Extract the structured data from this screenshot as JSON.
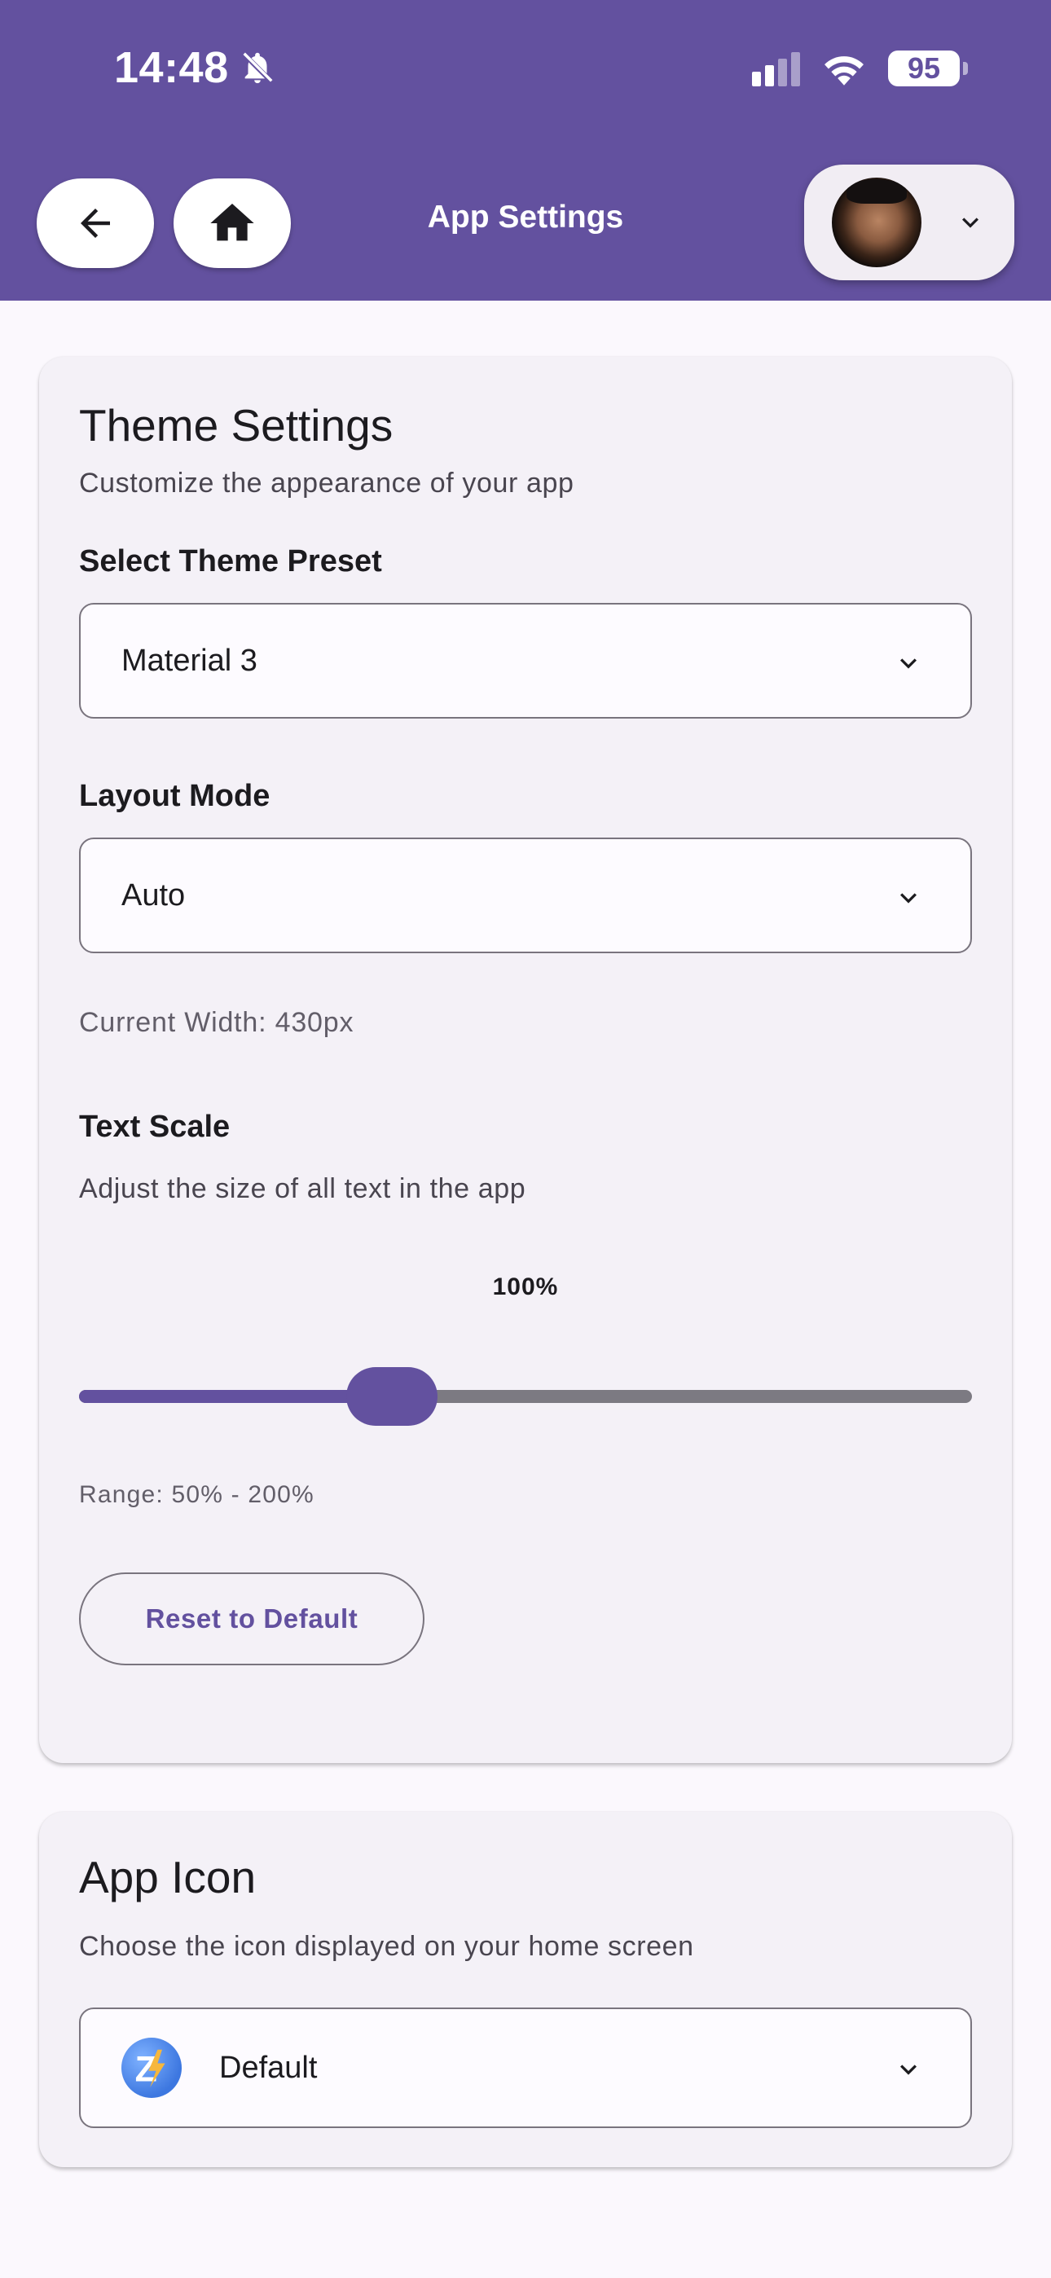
{
  "status_bar": {
    "time": "14:48",
    "battery": "95",
    "icons": [
      "bell-off-icon",
      "cellular-signal-icon",
      "wifi-icon",
      "battery-icon"
    ]
  },
  "header": {
    "title": "App Settings",
    "back_icon": "arrow-back-icon",
    "home_icon": "home-icon",
    "account_menu_icon": "chevron-down-icon"
  },
  "colors": {
    "primary": "#63519f",
    "surface": "#f4f1f7",
    "background": "#fbf8fd",
    "outline": "#79747e"
  },
  "theme_settings": {
    "title": "Theme Settings",
    "subtitle": "Customize the appearance of your app",
    "preset": {
      "label": "Select Theme Preset",
      "selected": "Material 3"
    },
    "layout": {
      "label": "Layout Mode",
      "selected": "Auto"
    },
    "current_width": "Current Width: 430px",
    "text_scale": {
      "label": "Text Scale",
      "description": "Adjust the size of all text in the app",
      "value_label": "100%",
      "value": 100,
      "min": 50,
      "max": 200,
      "range_text": "Range: 50% - 200%"
    },
    "reset_label": "Reset to Default"
  },
  "app_icon": {
    "title": "App Icon",
    "subtitle": "Choose the icon displayed on your home screen",
    "selected": "Default",
    "icon": "app-logo-icon"
  }
}
